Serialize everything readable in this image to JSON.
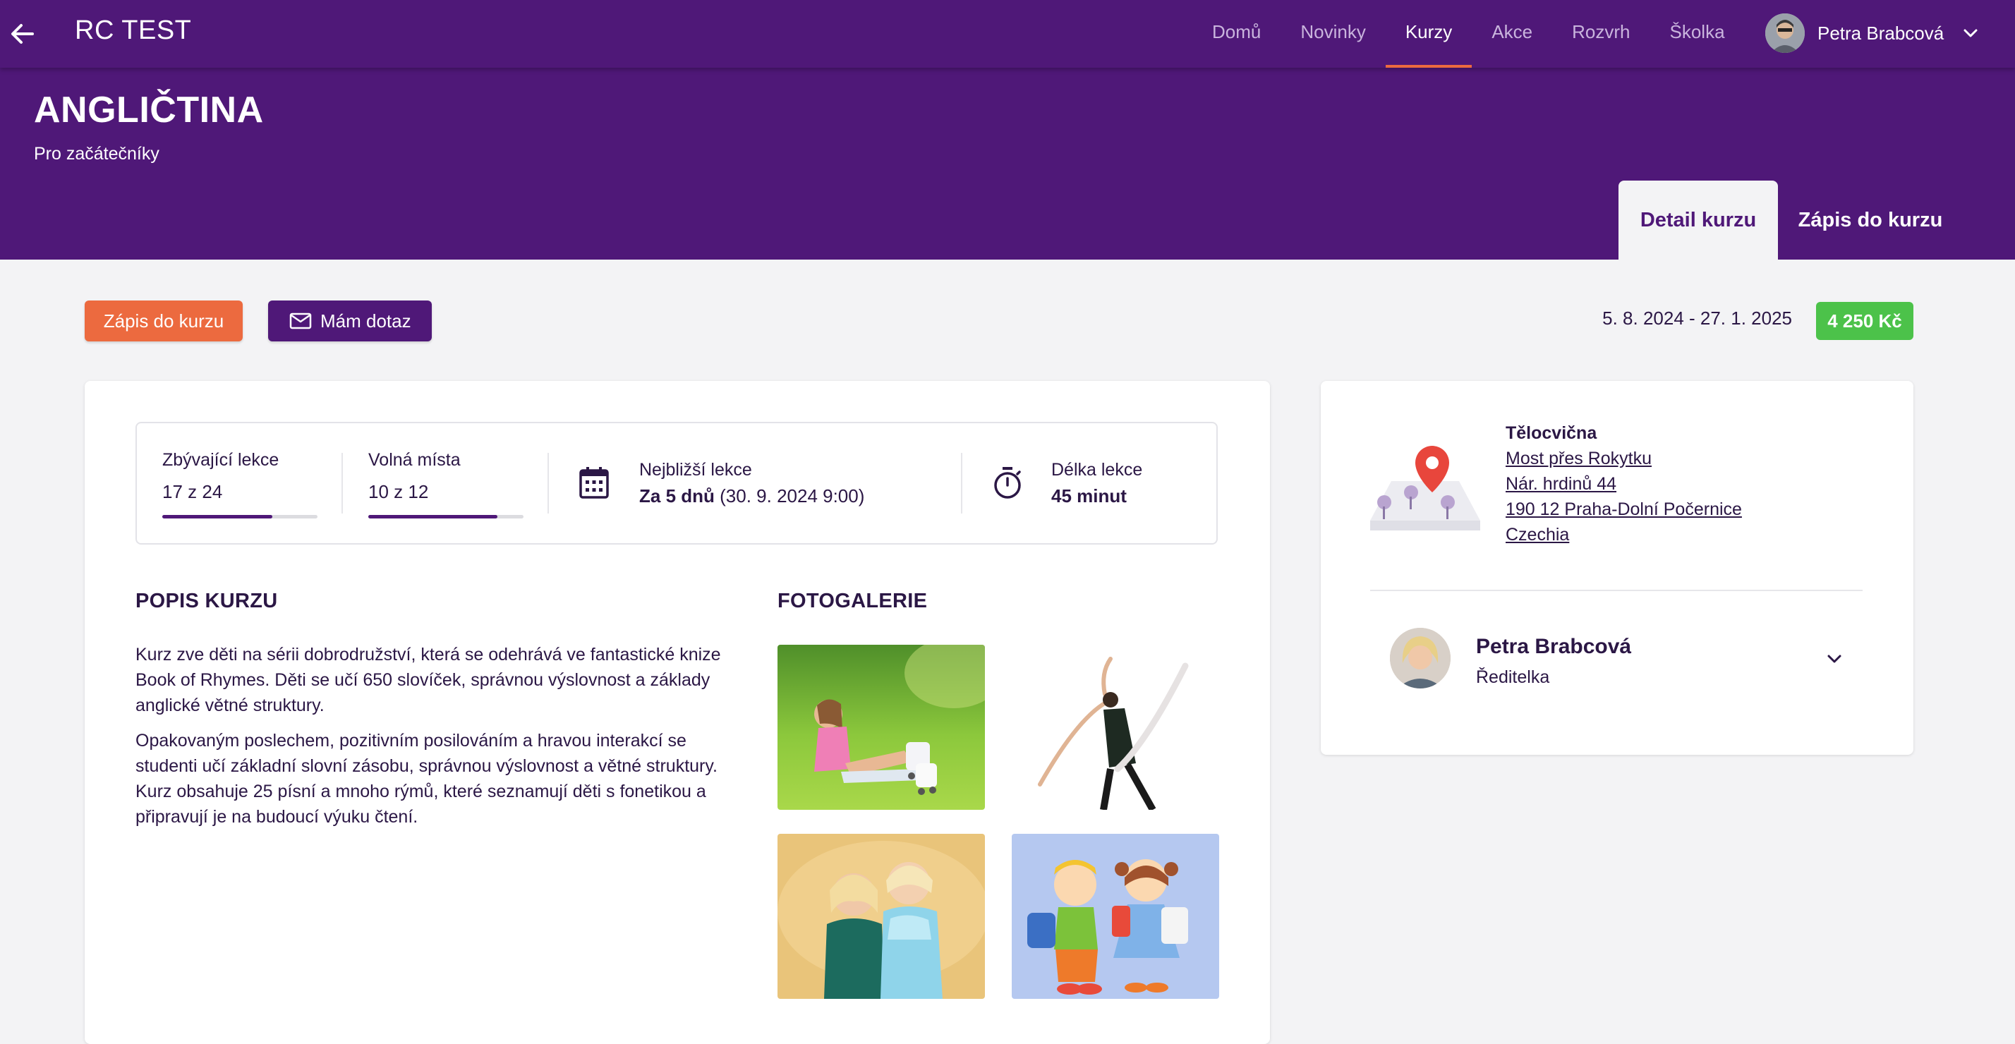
{
  "header": {
    "title": "RC TEST",
    "nav": [
      {
        "label": "Domů"
      },
      {
        "label": "Novinky"
      },
      {
        "label": "Kurzy",
        "active": true
      },
      {
        "label": "Akce"
      },
      {
        "label": "Rozvrh"
      },
      {
        "label": "Školka"
      }
    ],
    "user_name": "Petra Brabcová"
  },
  "course": {
    "title": "ANGLIČTINA",
    "subtitle": "Pro začátečníky"
  },
  "tabs": [
    {
      "label": "Detail kurzu",
      "active": true
    },
    {
      "label": "Zápis do kurzu"
    }
  ],
  "actions": {
    "enroll_label": "Zápis do kurzu",
    "ask_label": "Mám dotaz",
    "date_range": "5. 8. 2024 - 27. 1. 2025",
    "price": "4 250 Kč"
  },
  "stats": {
    "remaining": {
      "label": "Zbývající lekce",
      "value": "17 z 24",
      "progress": 0.708
    },
    "free": {
      "label": "Volná místa",
      "value": "10 z 12",
      "progress": 0.833
    },
    "next": {
      "label": "Nejbližší lekce",
      "value_bold": "Za 5 dnů",
      "value_rest": " (30. 9. 2024 9:00)"
    },
    "length": {
      "label": "Délka lekce",
      "value": "45 minut"
    }
  },
  "description": {
    "title": "POPIS KURZU",
    "paragraphs": [
      "Kurz zve děti na sérii dobrodružství, která se odehrává ve fantastické knize Book of Rhymes. Děti se učí 650 slovíček, správnou výslovnost a základy anglické větné struktury.",
      "Opakovaným poslechem, pozitivním posilováním a hravou interakcí se studenti učí základní slovní zásobu, správnou výslovnost a větné struktury. Kurz obsahuje 25 písní a mnoho rýmů, které seznamují děti s fonetikou a připravují je na budoucí výuku čtení."
    ]
  },
  "gallery": {
    "title": "FOTOGALERIE",
    "photos": [
      "girl-rollerblades",
      "ballet-dancer",
      "children-costumes",
      "cartoon-schoolkids"
    ]
  },
  "location": {
    "name": "Tělocvična",
    "address_lines": [
      "Most přes Rokytku",
      "Nár. hrdinů 44",
      "190 12 Praha-Dolní Počernice",
      "Czechia"
    ],
    "icon": "map-pin-icon"
  },
  "contact": {
    "name": "Petra Brabcová",
    "role": "Ředitelka"
  },
  "colors": {
    "primary": "#4f1878",
    "accent": "#ec6a3f",
    "price": "#4cc24a",
    "background": "#f3f3f5"
  }
}
